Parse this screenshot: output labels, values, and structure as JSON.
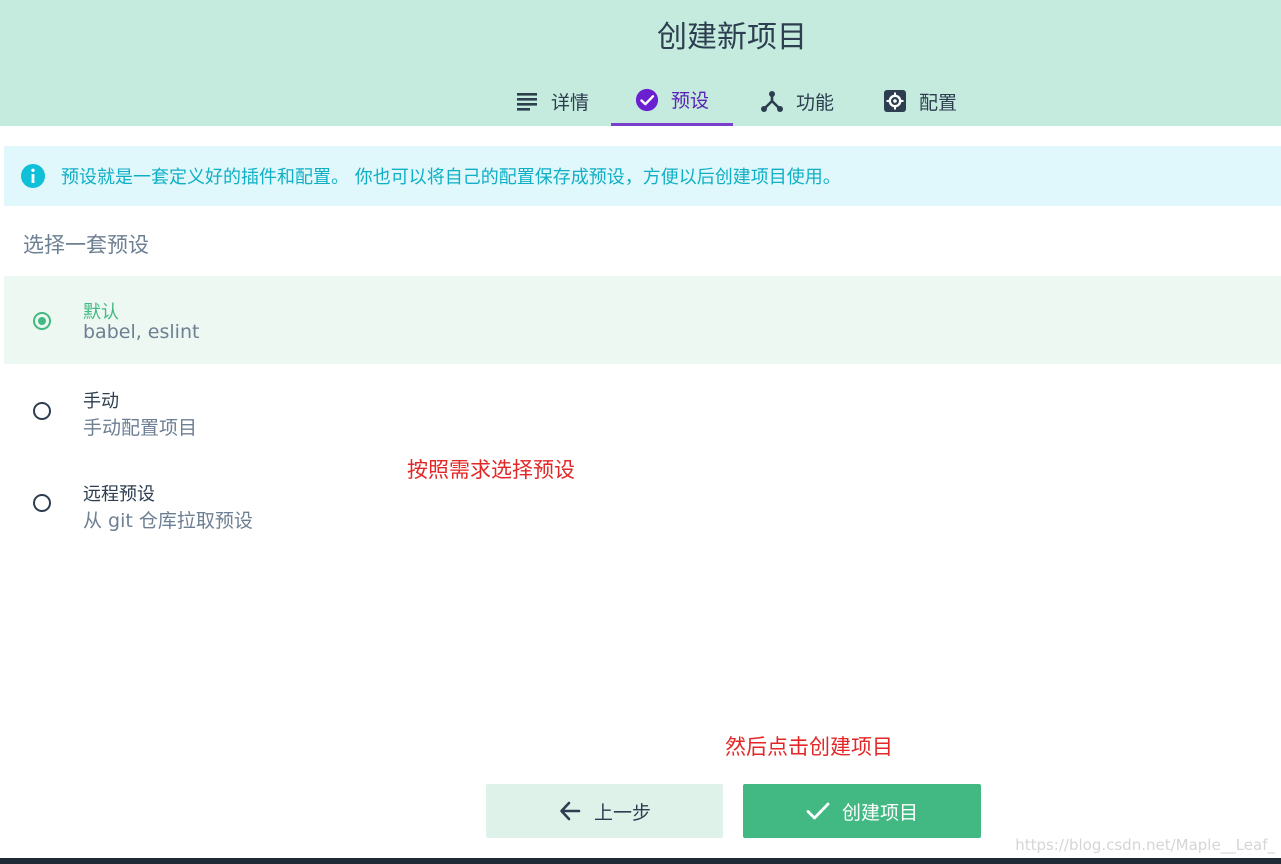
{
  "header": {
    "title": "创建新项目",
    "tabs": [
      {
        "label": "详情",
        "icon": "list-icon"
      },
      {
        "label": "预设",
        "icon": "check-circle-icon",
        "active": true
      },
      {
        "label": "功能",
        "icon": "fork-icon"
      },
      {
        "label": "配置",
        "icon": "settings-gear-icon"
      }
    ]
  },
  "info": {
    "icon": "info-icon",
    "text": "预设就是一套定义好的插件和配置。 你也可以将自己的配置保存成预设，方便以后创建项目使用。"
  },
  "presets": {
    "title": "选择一套预设",
    "options": [
      {
        "name": "默认",
        "desc": "babel, eslint",
        "selected": true
      },
      {
        "name": "手动",
        "desc": "手动配置项目",
        "selected": false
      },
      {
        "name": "远程预设",
        "desc": "从 git 仓库拉取预设",
        "selected": false
      }
    ]
  },
  "annotations": {
    "select_note": "按照需求选择预设",
    "create_note": "然后点击创建项目"
  },
  "buttons": {
    "prev_label": "上一步",
    "create_label": "创建项目"
  },
  "watermark": "https://blog.csdn.net/Maple__Leaf_",
  "colors": {
    "header_bg": "#c5ebde",
    "accent_green": "#42b983",
    "active_tab": "#7b3fd0",
    "info_text": "#0fb0c6",
    "annotation_red": "#e32626"
  }
}
